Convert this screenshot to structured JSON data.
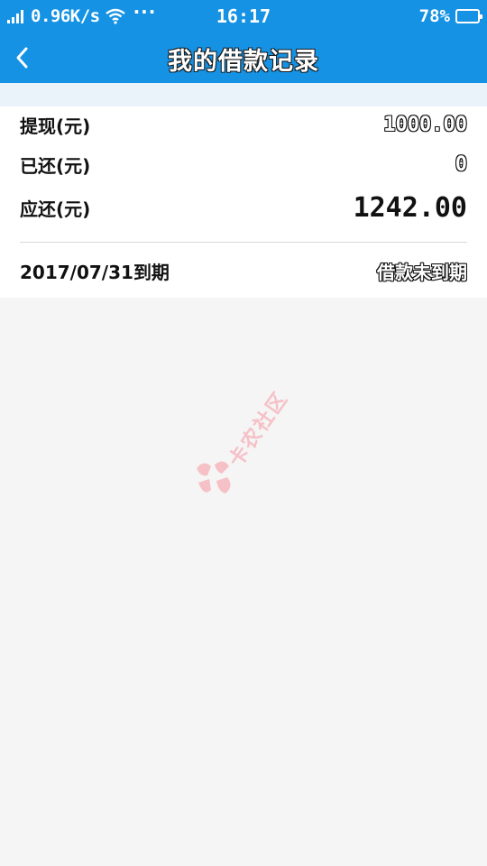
{
  "status_bar": {
    "net_speed": "0.96K/s",
    "more": "···",
    "time": "16:17",
    "battery": "78%",
    "battery_level": 0.78
  },
  "navbar": {
    "title": "我的借款记录"
  },
  "loan": {
    "withdraw_label": "提现(元)",
    "withdraw_value": "1000.00",
    "repaid_label": "已还(元)",
    "repaid_value": "0",
    "due_label": "应还(元)",
    "due_value": "1242.00",
    "due_date": "2017/07/31到期",
    "status": "借款未到期"
  },
  "watermark": {
    "text": "卡农社区",
    "color": "#f6b8c0"
  },
  "colors": {
    "header": "#1592e3",
    "background": "#f5f5f5",
    "card": "#ffffff"
  }
}
